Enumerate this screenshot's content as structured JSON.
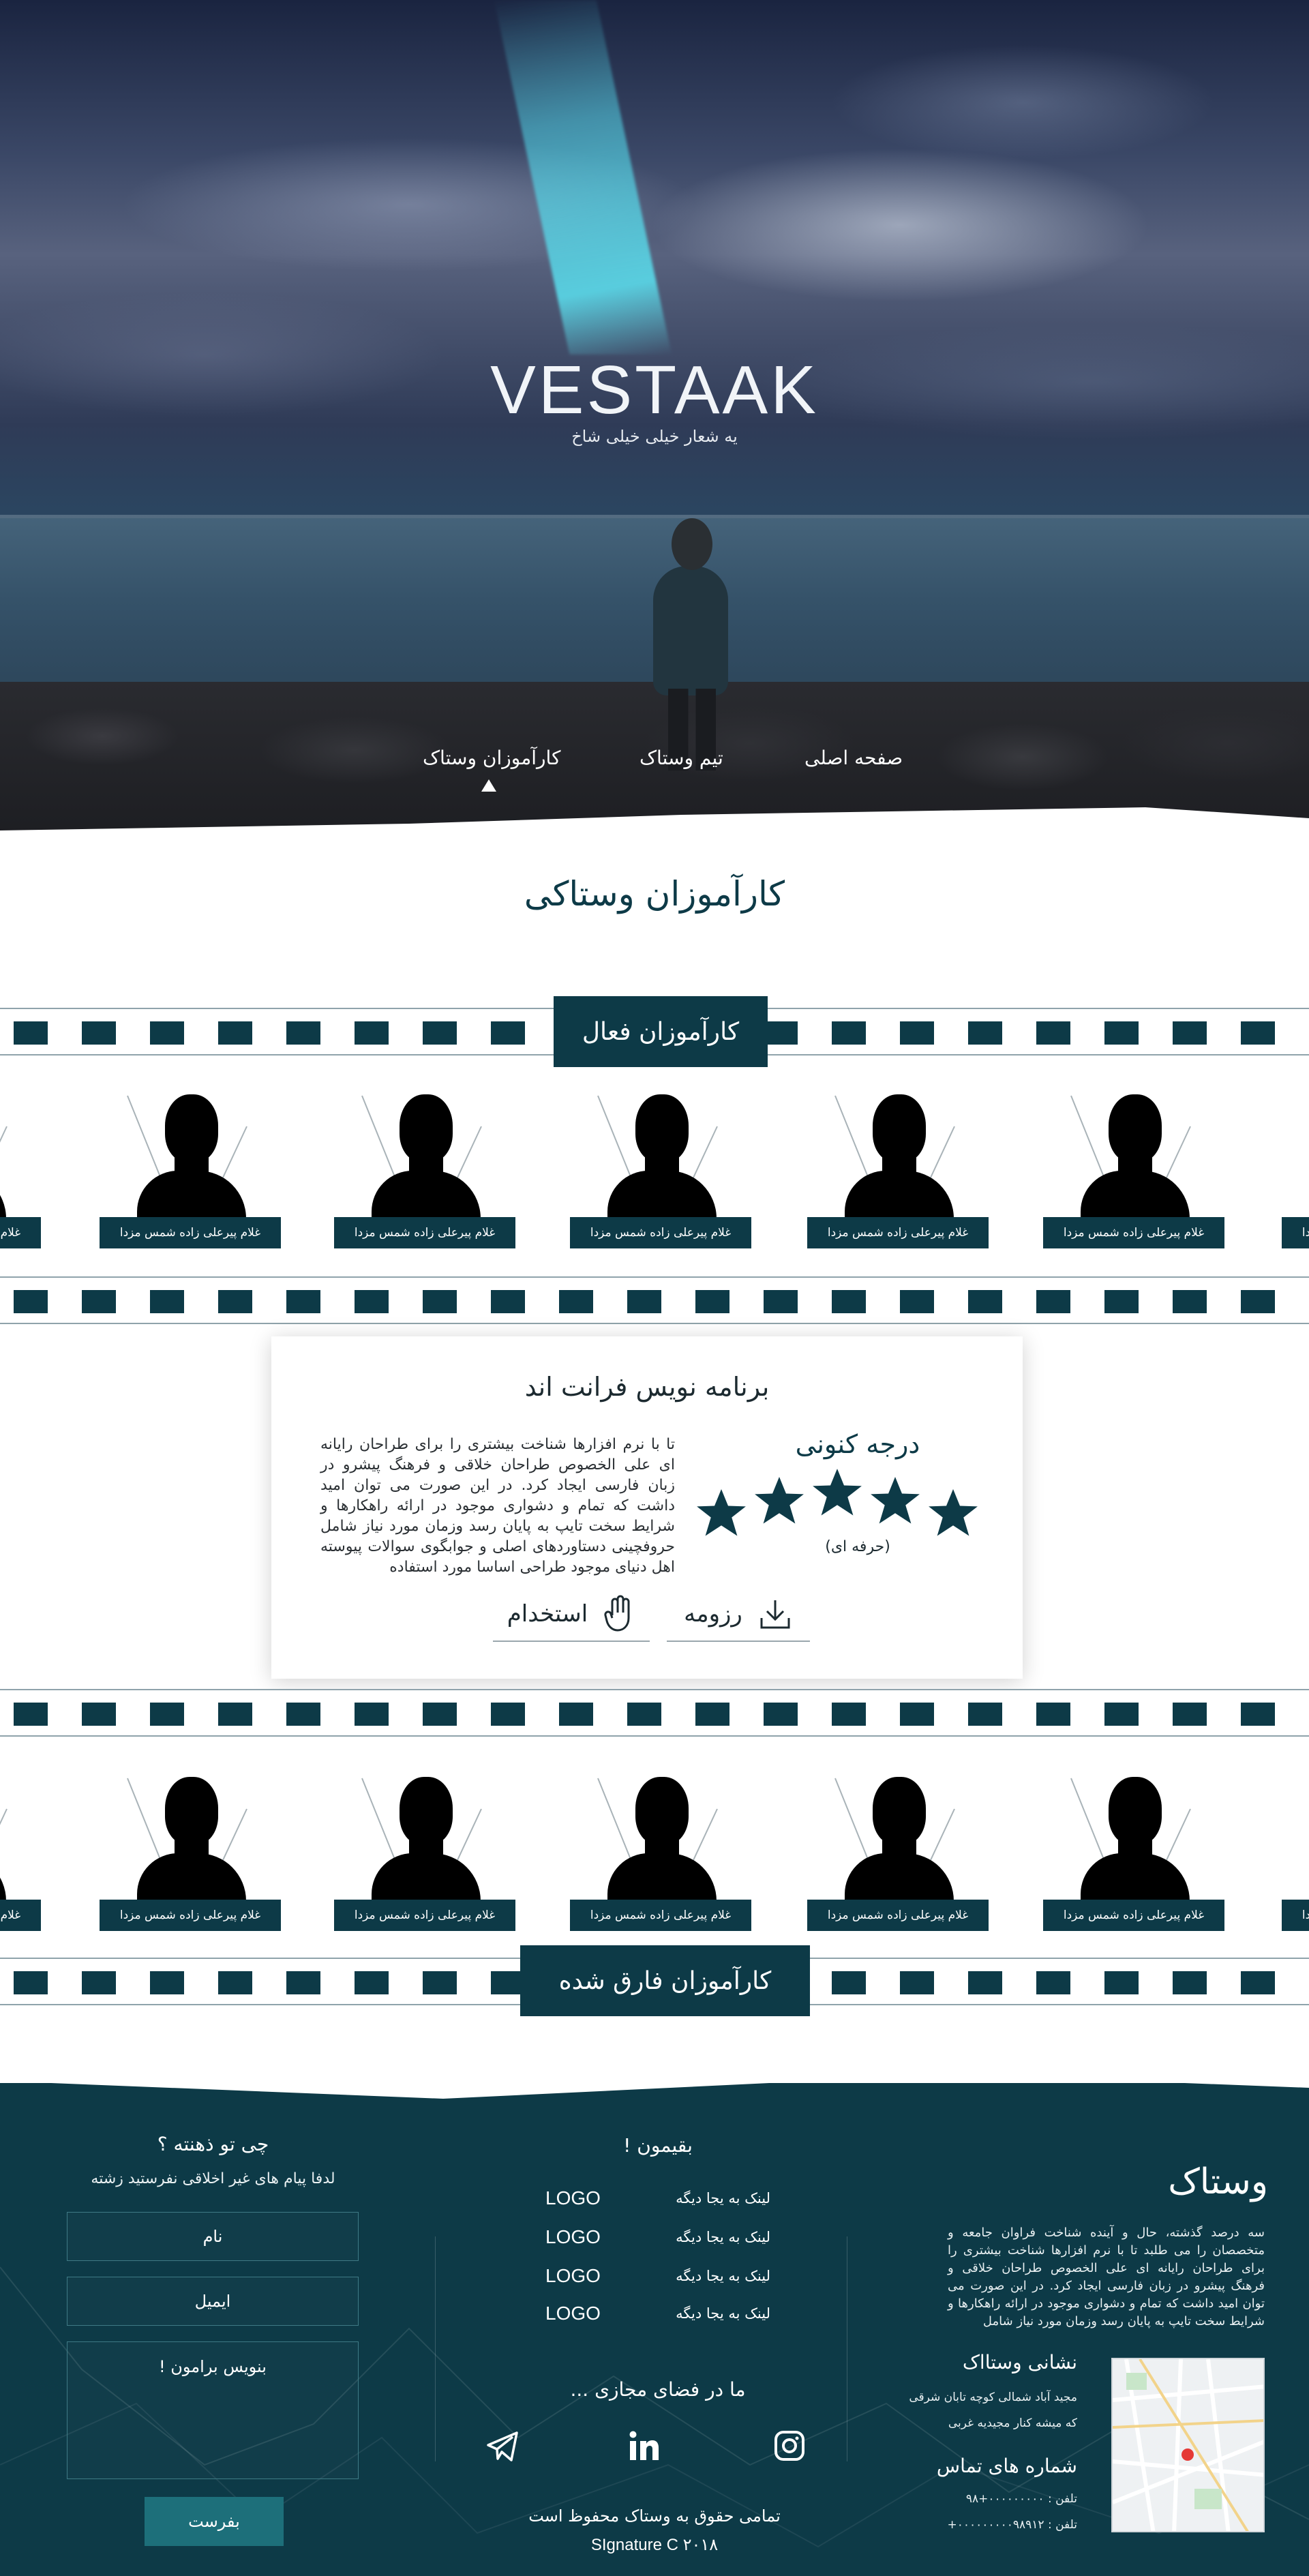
{
  "hero": {
    "title": "VESTAAK",
    "slogan": "یه شعار خیلی خیلی شاخ"
  },
  "nav": {
    "items": [
      "صفحه اصلی",
      "تیم وستاک",
      "کارآموزان وستاک"
    ],
    "active": "کارآموزان وستاک"
  },
  "page_title": "کارآموزان وستاکی",
  "active_interns": {
    "label": "کارآموزان فعال",
    "names": [
      "غلام پیرعلی زاده شمس مزدا",
      "غلام پیرعلی زاده شمس مزدا",
      "غلام پیرعلی زاده شمس مزدا",
      "غلام پیرعلی زاده شمس مزدا",
      "غلام پیرعلی زاده شمس مزدا",
      "غلام پیرعلی زاده شمس مزدا",
      "غلام پیرعلی زاده شمس مزدا",
      "غلام پیرعلی زاده شمس مزدا"
    ]
  },
  "detail_card": {
    "title": "برنامه نویس فرانت اند",
    "description": "تا با نرم افزارها شناخت بیشتری را برای طراحان رایانه ای علی الخصوص طراحان خلاقی و فرهنگ پیشرو در زبان فارسی ایجاد کرد. در این صورت می توان امید داشت که تمام و دشواری موجود در ارائه راهکارها و شرایط سخت تایپ به پایان رسد وزمان مورد نیاز شامل حروفچینی دستاوردهای اصلی و جوابگوی سوالات پیوسته اهل دنیای موجود طراحی اساسا مورد استفاده",
    "rating_title": "درجه کنونی",
    "rating_value": 5,
    "rating_max": 5,
    "rating_level": "(حرفه ای)",
    "resume_label": "رزومه",
    "hire_label": "استخدام"
  },
  "graduated_interns": {
    "label": "کارآموزان فارق شده",
    "names": [
      "غلام پیرعلی زاده شمس مزدا",
      "غلام پیرعلی زاده شمس مزدا",
      "غلام پیرعلی زاده شمس مزدا",
      "غلام پیرعلی زاده شمس مزدا",
      "غلام پیرعلی زاده شمس مزدا",
      "غلام پیرعلی زاده شمس مزدا",
      "غلام پیرعلی زاده شمس مزدا",
      "غلام پیرعلی زاده شمس مزدا"
    ]
  },
  "footer": {
    "about": {
      "title": "وستاک",
      "text": "سه درصد گذشته، حال و آینده شناخت فراوان جامعه و متخصصان را می طلبد تا با نرم افزارها شناخت بیشتری را برای طراحان رایانه ای علی الخصوص طراحان خلاقی و فرهنگ پیشرو در زبان فارسی ایجاد کرد. در این صورت می توان امید داشت که تمام و دشواری موجود در ارائه راهکارها و شرایط سخت تایپ به پایان رسد وزمان مورد نیاز شامل"
    },
    "address": {
      "title": "نشانی وستااک",
      "line1": "مجید آباد شمالی کوچه تابان شرقی",
      "line2": "که میشه کنار مجیدیه غربی"
    },
    "contact": {
      "title": "شماره های تماس",
      "phone1": "تلفن : ۰۰۰۰۰۰۰۰۰+۹۸",
      "phone2": "تلفن : ۰۰۰۰۰۰۰۰۰۹۸۹۱۲+"
    },
    "links": {
      "title": "! بقیمون",
      "items": [
        {
          "text": "لینک به یجا دیگه",
          "logo": "LOGO"
        },
        {
          "text": "لینک به یجا دیگه",
          "logo": "LOGO"
        },
        {
          "text": "لینک به یجا دیگه",
          "logo": "LOGO"
        },
        {
          "text": "لینک به یجا دیگه",
          "logo": "LOGO"
        }
      ]
    },
    "social": {
      "title": "... ما در فضای مجازی",
      "icons": [
        "telegram-icon",
        "linkedin-icon",
        "instagram-icon"
      ]
    },
    "form": {
      "title": "چی تو ذهنته ؟",
      "note": "لدفا پیام های غیر اخلاقی نفرستید زشته",
      "name_placeholder": "نام",
      "email_placeholder": "ایمیل",
      "message_placeholder": "! بنویس برامون",
      "submit_label": "بفرست"
    },
    "copyright": "تمامی حقوق به وستاک محفوظ است",
    "signature": "SIgnature C ۲۰۱۸"
  },
  "colors": {
    "primary": "#0d3a47",
    "button": "#1d6f7a",
    "accent_beam": "#5fd8e8"
  }
}
